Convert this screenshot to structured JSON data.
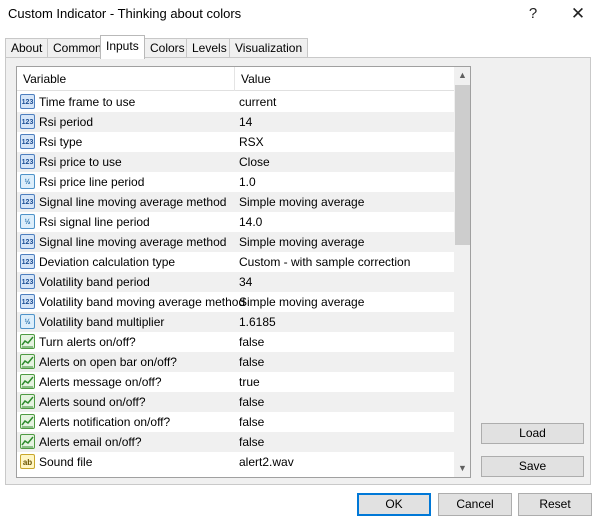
{
  "window": {
    "title": "Custom Indicator - Thinking about colors",
    "help_glyph": "?",
    "close_glyph": "✕"
  },
  "tabs": [
    {
      "label": "About"
    },
    {
      "label": "Common"
    },
    {
      "label": "Inputs",
      "active": true
    },
    {
      "label": "Colors"
    },
    {
      "label": "Levels"
    },
    {
      "label": "Visualization"
    }
  ],
  "grid": {
    "header": {
      "variable": "Variable",
      "value": "Value"
    },
    "rows": [
      {
        "icon": "integer-icon",
        "icon_text": "123",
        "variable": "Time frame to use",
        "value": "current"
      },
      {
        "icon": "integer-icon",
        "icon_text": "123",
        "variable": "Rsi period",
        "value": "14"
      },
      {
        "icon": "integer-icon",
        "icon_text": "123",
        "variable": "Rsi type",
        "value": "RSX"
      },
      {
        "icon": "integer-icon",
        "icon_text": "123",
        "variable": "Rsi price to use",
        "value": "Close"
      },
      {
        "icon": "double-icon",
        "icon_text": "½",
        "variable": "Rsi price line period",
        "value": "1.0"
      },
      {
        "icon": "integer-icon",
        "icon_text": "123",
        "variable": "Signal line moving average method",
        "value": "Simple moving average"
      },
      {
        "icon": "double-icon",
        "icon_text": "½",
        "variable": "Rsi signal line period",
        "value": "14.0"
      },
      {
        "icon": "integer-icon",
        "icon_text": "123",
        "variable": "Signal line moving average method",
        "value": "Simple moving average"
      },
      {
        "icon": "integer-icon",
        "icon_text": "123",
        "variable": "Deviation calculation type",
        "value": "Custom - with sample correction"
      },
      {
        "icon": "integer-icon",
        "icon_text": "123",
        "variable": "Volatility band period",
        "value": "34"
      },
      {
        "icon": "integer-icon",
        "icon_text": "123",
        "variable": "Volatility band moving average method",
        "value": "Simple moving average"
      },
      {
        "icon": "double-icon",
        "icon_text": "½",
        "variable": "Volatility band multiplier",
        "value": "1.6185"
      },
      {
        "icon": "boolean-icon",
        "icon_text": "",
        "variable": "Turn alerts on/off?",
        "value": "false"
      },
      {
        "icon": "boolean-icon",
        "icon_text": "",
        "variable": "Alerts on open bar on/off?",
        "value": "false"
      },
      {
        "icon": "boolean-icon",
        "icon_text": "",
        "variable": "Alerts message on/off?",
        "value": "true"
      },
      {
        "icon": "boolean-icon",
        "icon_text": "",
        "variable": "Alerts sound on/off?",
        "value": "false"
      },
      {
        "icon": "boolean-icon",
        "icon_text": "",
        "variable": "Alerts notification on/off?",
        "value": "false"
      },
      {
        "icon": "boolean-icon",
        "icon_text": "",
        "variable": "Alerts email on/off?",
        "value": "false"
      },
      {
        "icon": "string-icon",
        "icon_text": "ab",
        "variable": "Sound file",
        "value": "alert2.wav"
      }
    ]
  },
  "scrollbar": {
    "up_glyph": "▲",
    "down_glyph": "▼"
  },
  "side_buttons": {
    "load": "Load",
    "save": "Save"
  },
  "footer_buttons": {
    "ok": "OK",
    "cancel": "Cancel",
    "reset": "Reset"
  }
}
